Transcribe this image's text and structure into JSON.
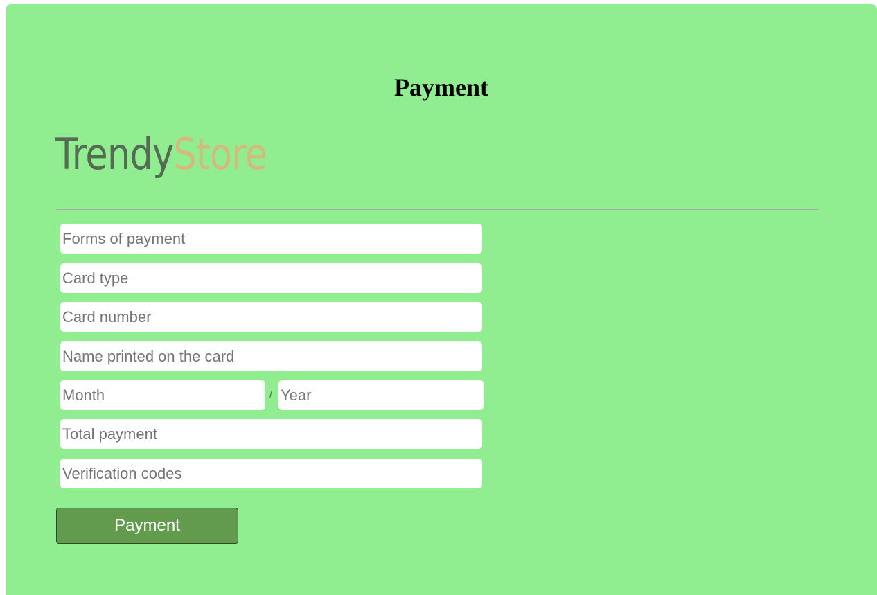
{
  "page": {
    "title": "Payment",
    "background_color": "#90ee90"
  },
  "logo": {
    "part1": "Trendy",
    "part2": "Store",
    "part1_color": "#556b53",
    "part2_color": "#d5ba7e"
  },
  "form": {
    "forms_of_payment_placeholder": "Forms of payment",
    "card_type_placeholder": "Card type",
    "card_number_placeholder": "Card number",
    "name_on_card_placeholder": "Name printed on the card",
    "month_placeholder": "Month",
    "date_separator": "/",
    "year_placeholder": "Year",
    "total_payment_placeholder": "Total payment",
    "verification_codes_placeholder": "Verification codes",
    "submit_label": "Payment",
    "submit_color": "#629b4d"
  }
}
